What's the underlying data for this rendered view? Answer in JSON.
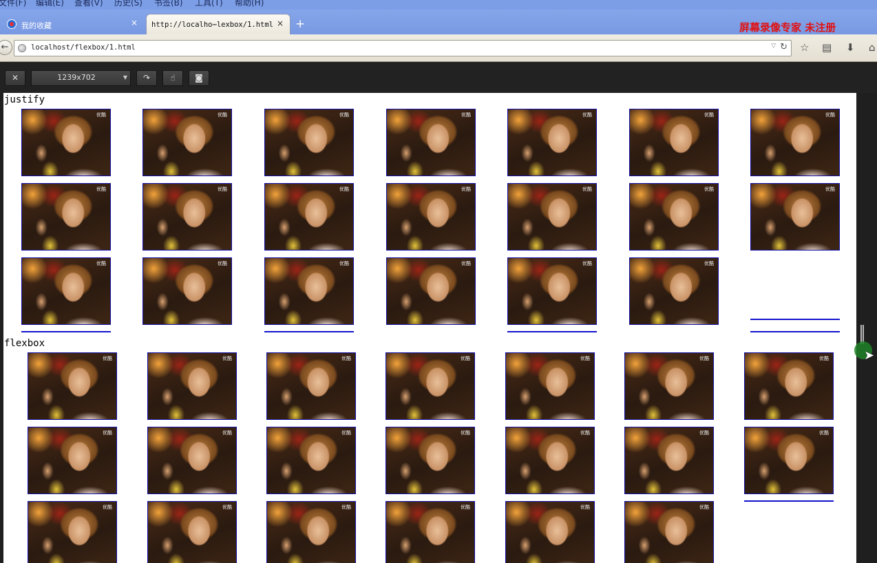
{
  "menu": {
    "items": [
      "文件(F)",
      "编辑(E)",
      "查看(V)",
      "历史(S)",
      "书签(B)",
      "工具(T)",
      "帮助(H)"
    ]
  },
  "tabs": [
    {
      "title": "我的收藏",
      "close": "×"
    },
    {
      "title": "http://localho⋯lexbox/1.html",
      "close": "×"
    }
  ],
  "new_tab": "+",
  "watermark": "屏幕录像专家  未注册",
  "navbar": {
    "back": "←",
    "url": "localhost/flexbox/1.html",
    "dropdown": "▽",
    "reload": "↻",
    "icons": {
      "bookmark": "☆",
      "reader": "▤",
      "download": "⬇",
      "home": "⌂"
    }
  },
  "devtools": {
    "close_label": "✕",
    "size_value": "1239x702",
    "size_arrow": "▼",
    "rotate_label": "↷",
    "touch_label": "☝",
    "screenshot_label": "◙"
  },
  "page": {
    "sections": [
      {
        "label": "justify",
        "columns": 7,
        "items": 20,
        "placeholders": 1
      },
      {
        "label": "flexbox",
        "columns": 7,
        "items": 20,
        "placeholders": 1
      }
    ],
    "photo_watermark": "优酷"
  }
}
